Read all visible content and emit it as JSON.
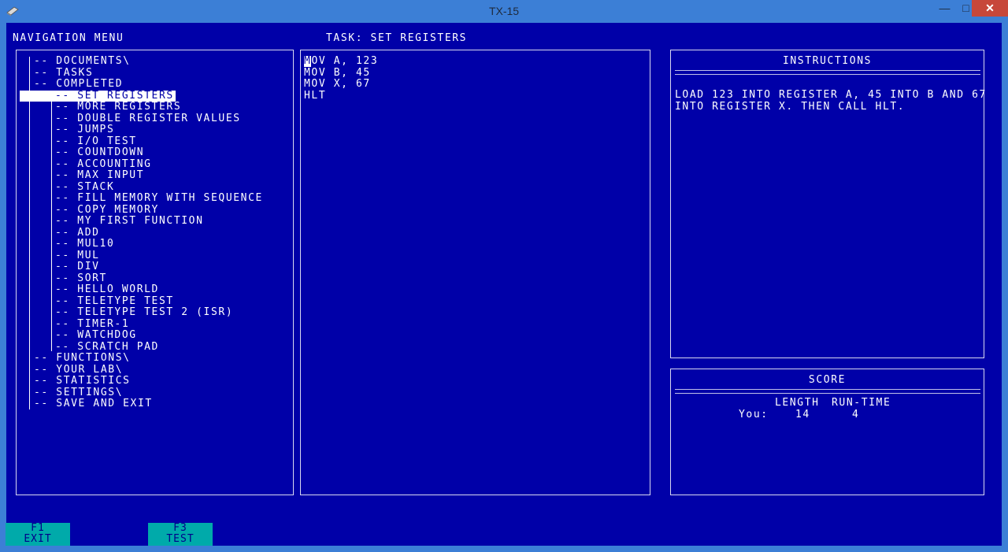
{
  "window": {
    "title": "TX-15"
  },
  "headers": {
    "nav": "NAVIGATION MENU",
    "task": "TASK: SET REGISTERS"
  },
  "nav": {
    "items": [
      {
        "label": "-- DOCUMENTS\\",
        "level": 1
      },
      {
        "label": "-- TASKS",
        "level": 1
      },
      {
        "label": "-- COMPLETED",
        "level": 1
      },
      {
        "label": "-- SET REGISTERS",
        "level": 2,
        "selected": true
      },
      {
        "label": "-- MORE REGISTERS",
        "level": 2
      },
      {
        "label": "-- DOUBLE REGISTER VALUES",
        "level": 2
      },
      {
        "label": "-- JUMPS",
        "level": 2
      },
      {
        "label": "-- I/O TEST",
        "level": 2
      },
      {
        "label": "-- COUNTDOWN",
        "level": 2
      },
      {
        "label": "-- ACCOUNTING",
        "level": 2
      },
      {
        "label": "-- MAX INPUT",
        "level": 2
      },
      {
        "label": "-- STACK",
        "level": 2
      },
      {
        "label": "-- FILL MEMORY WITH SEQUENCE",
        "level": 2
      },
      {
        "label": "-- COPY MEMORY",
        "level": 2
      },
      {
        "label": "-- MY FIRST FUNCTION",
        "level": 2
      },
      {
        "label": "-- ADD",
        "level": 2
      },
      {
        "label": "-- MUL10",
        "level": 2
      },
      {
        "label": "-- MUL",
        "level": 2
      },
      {
        "label": "-- DIV",
        "level": 2
      },
      {
        "label": "-- SORT",
        "level": 2
      },
      {
        "label": "-- HELLO WORLD",
        "level": 2
      },
      {
        "label": "-- TELETYPE TEST",
        "level": 2
      },
      {
        "label": "-- TELETYPE TEST 2 (ISR)",
        "level": 2
      },
      {
        "label": "-- TIMER-1",
        "level": 2
      },
      {
        "label": "-- WATCHDOG",
        "level": 2
      },
      {
        "label": "-- SCRATCH PAD",
        "level": 2
      },
      {
        "label": "-- FUNCTIONS\\",
        "level": 1
      },
      {
        "label": "-- YOUR LAB\\",
        "level": 1
      },
      {
        "label": "-- STATISTICS",
        "level": 1
      },
      {
        "label": "-- SETTINGS\\",
        "level": 1
      },
      {
        "label": "-- SAVE AND EXIT",
        "level": 1
      }
    ]
  },
  "editor": {
    "cursor_char": "M",
    "first_line_rest": "OV A, 123",
    "lines": [
      "MOV B, 45",
      "MOV X, 67",
      "HLT"
    ]
  },
  "instructions": {
    "title": "INSTRUCTIONS",
    "line1": "LOAD 123 INTO REGISTER A, 45 INTO B AND 67",
    "line2": "INTO REGISTER X. THEN CALL HLT."
  },
  "score": {
    "title": "SCORE",
    "col_length": "LENGTH",
    "col_runtime": "RUN-TIME",
    "row_label": "You:",
    "length": "14",
    "runtime": "4"
  },
  "fkeys": [
    {
      "key": "F1",
      "label": "EXIT"
    },
    {
      "key": "F3",
      "label": "TEST"
    }
  ]
}
